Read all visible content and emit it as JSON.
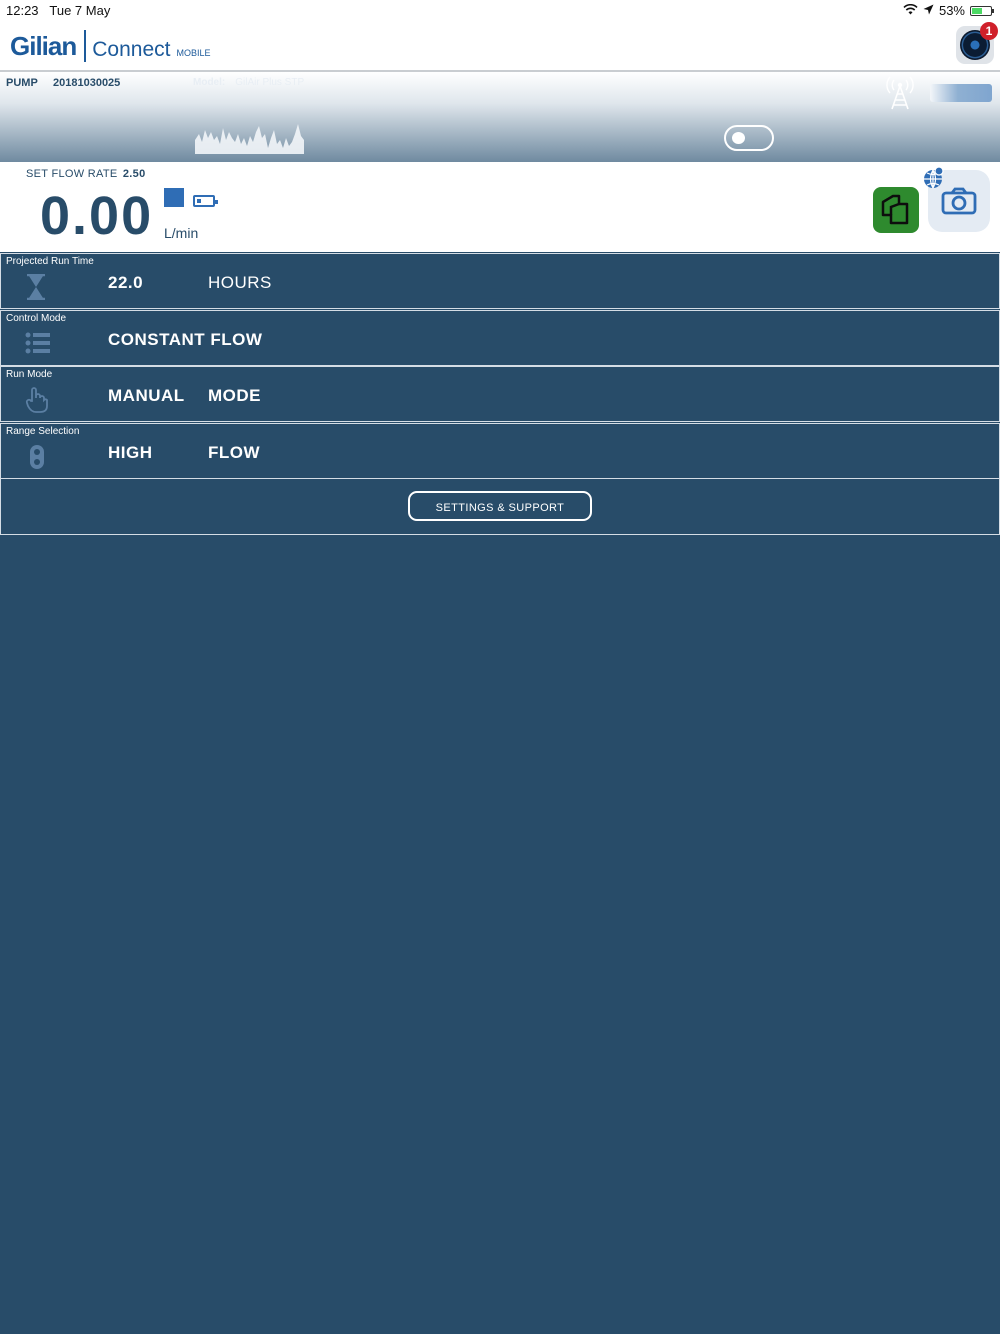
{
  "status_bar": {
    "time": "12:23",
    "date": "Tue 7 May",
    "battery_percent": "53%",
    "battery_level": 0.53,
    "icons": [
      "wifi-icon",
      "location-arrow-icon",
      "battery-charging-icon"
    ]
  },
  "header": {
    "logo_brand": "Gilian",
    "logo_product": "Connect",
    "logo_edition": "MOBILE",
    "notification_count": "1"
  },
  "pump": {
    "label": "PUMP",
    "serial": "20181030025",
    "model_label": "Model:",
    "model_value": "GilAir Plus STP"
  },
  "flow": {
    "set_label": "SET FLOW RATE",
    "set_value": "2.50",
    "current_value": "0.00",
    "unit": "L/min"
  },
  "rows": [
    {
      "caption": "Projected Run Time",
      "value1": "22.0",
      "value2": "HOURS",
      "icon": "hourglass-icon"
    },
    {
      "caption": "Control Mode",
      "value1": "CONSTANT FLOW",
      "value2": "",
      "icon": "list-icon"
    },
    {
      "caption": "Run Mode",
      "value1": "MANUAL",
      "value2": "MODE",
      "icon": "hand-pointer-icon"
    },
    {
      "caption": "Range Selection",
      "value1": "HIGH",
      "value2": "FLOW",
      "icon": "range-icon"
    }
  ],
  "settings": {
    "label": "SETTINGS & SUPPORT"
  },
  "colors": {
    "primary": "#284c69",
    "accent_blue": "#2f6db5",
    "copy_green": "#2e8a2e",
    "badge_red": "#d0202a"
  }
}
